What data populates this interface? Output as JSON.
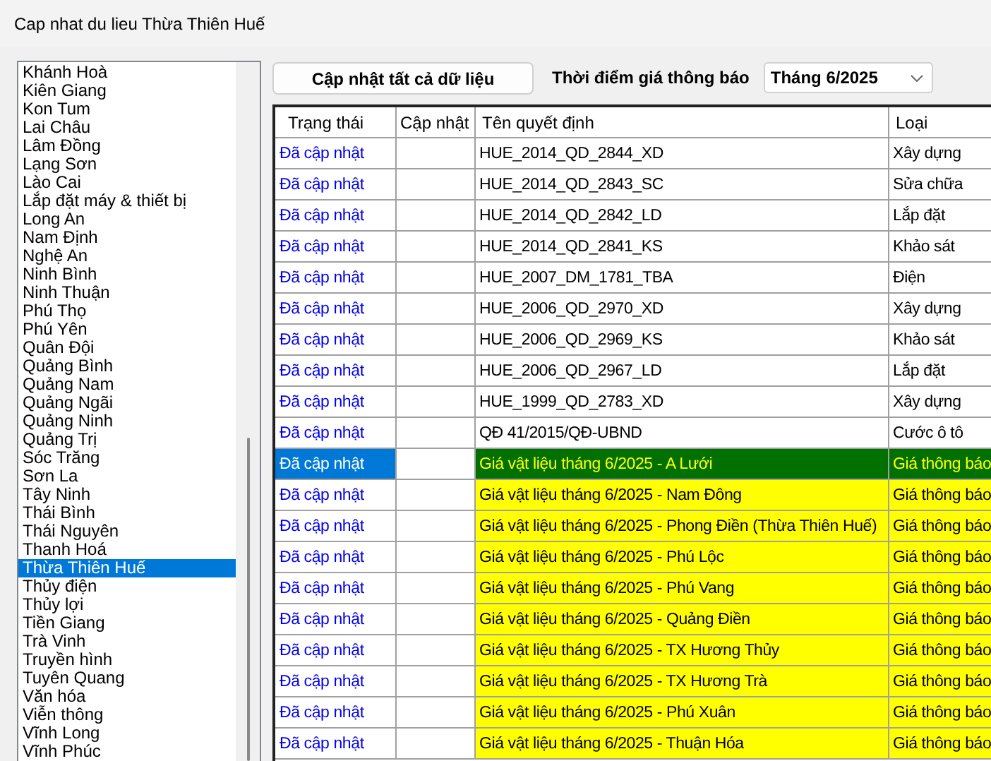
{
  "window": {
    "title": "Cap nhat du lieu Thừa Thiên Huế"
  },
  "list": [
    {
      "label": "Khánh Hoà",
      "selected": false
    },
    {
      "label": "Kiên Giang",
      "selected": false
    },
    {
      "label": "Kon Tum",
      "selected": false
    },
    {
      "label": "Lai Châu",
      "selected": false
    },
    {
      "label": "Lâm Đồng",
      "selected": false
    },
    {
      "label": "Lạng Sơn",
      "selected": false
    },
    {
      "label": "Lào Cai",
      "selected": false
    },
    {
      "label": "Lắp đặt máy & thiết bị",
      "selected": false
    },
    {
      "label": "Long An",
      "selected": false
    },
    {
      "label": "Nam Định",
      "selected": false
    },
    {
      "label": "Nghệ An",
      "selected": false
    },
    {
      "label": "Ninh Bình",
      "selected": false
    },
    {
      "label": "Ninh Thuận",
      "selected": false
    },
    {
      "label": "Phú Thọ",
      "selected": false
    },
    {
      "label": "Phú Yên",
      "selected": false
    },
    {
      "label": "Quân Đội",
      "selected": false
    },
    {
      "label": "Quảng Bình",
      "selected": false
    },
    {
      "label": "Quảng Nam",
      "selected": false
    },
    {
      "label": "Quảng Ngãi",
      "selected": false
    },
    {
      "label": "Quảng Ninh",
      "selected": false
    },
    {
      "label": "Quảng Trị",
      "selected": false
    },
    {
      "label": "Sóc Trăng",
      "selected": false
    },
    {
      "label": "Sơn La",
      "selected": false
    },
    {
      "label": "Tây Ninh",
      "selected": false
    },
    {
      "label": "Thái Bình",
      "selected": false
    },
    {
      "label": "Thái Nguyên",
      "selected": false
    },
    {
      "label": "Thanh Hoá",
      "selected": false
    },
    {
      "label": "Thừa Thiên Huế",
      "selected": true
    },
    {
      "label": "Thủy điện",
      "selected": false
    },
    {
      "label": "Thủy lợi",
      "selected": false
    },
    {
      "label": "Tiền Giang",
      "selected": false
    },
    {
      "label": "Trà Vinh",
      "selected": false
    },
    {
      "label": "Truyền hình",
      "selected": false
    },
    {
      "label": "Tuyên Quang",
      "selected": false
    },
    {
      "label": "Văn hóa",
      "selected": false
    },
    {
      "label": "Viễn thông",
      "selected": false
    },
    {
      "label": "Vĩnh Long",
      "selected": false
    },
    {
      "label": "Vĩnh Phúc",
      "selected": false
    }
  ],
  "update_all_button": "Cập nhật tất cả dữ liệu",
  "period": {
    "label": "Thời điểm giá thông báo",
    "value": "Tháng 6/2025"
  },
  "table": {
    "columns": [
      "Trạng thái",
      "Cập nhật",
      "Tên quyết định",
      "Loại"
    ],
    "rows": [
      {
        "status": "Đã cập nhật",
        "name": "HUE_2014_QD_2844_XD",
        "type": "Xây dựng",
        "selected": false,
        "highlighted": false
      },
      {
        "status": "Đã cập nhật",
        "name": "HUE_2014_QD_2843_SC",
        "type": "Sửa chữa",
        "selected": false,
        "highlighted": false
      },
      {
        "status": "Đã cập nhật",
        "name": "HUE_2014_QD_2842_LD",
        "type": "Lắp đặt",
        "selected": false,
        "highlighted": false
      },
      {
        "status": "Đã cập nhật",
        "name": "HUE_2014_QD_2841_KS",
        "type": "Khảo sát",
        "selected": false,
        "highlighted": false
      },
      {
        "status": "Đã cập nhật",
        "name": "HUE_2007_DM_1781_TBA",
        "type": "Điện",
        "selected": false,
        "highlighted": false
      },
      {
        "status": "Đã cập nhật",
        "name": "HUE_2006_QD_2970_XD",
        "type": "Xây dựng",
        "selected": false,
        "highlighted": false
      },
      {
        "status": "Đã cập nhật",
        "name": "HUE_2006_QD_2969_KS",
        "type": "Khảo sát",
        "selected": false,
        "highlighted": false
      },
      {
        "status": "Đã cập nhật",
        "name": "HUE_2006_QD_2967_LD",
        "type": "Lắp đặt",
        "selected": false,
        "highlighted": false
      },
      {
        "status": "Đã cập nhật",
        "name": "HUE_1999_QD_2783_XD",
        "type": "Xây dựng",
        "selected": false,
        "highlighted": false
      },
      {
        "status": "Đã cập nhật",
        "name": "QĐ 41/2015/QĐ-UBND",
        "type": "Cước ô tô",
        "selected": false,
        "highlighted": false
      },
      {
        "status": "Đã cập nhật",
        "name": "Giá vật liệu tháng 6/2025 - A Lưới",
        "type": "Giá thông báo",
        "selected": true,
        "highlighted": true
      },
      {
        "status": "Đã cập nhật",
        "name": "Giá vật liệu tháng 6/2025 - Nam Đông",
        "type": "Giá thông báo",
        "selected": false,
        "highlighted": true
      },
      {
        "status": "Đã cập nhật",
        "name": "Giá vật liệu tháng 6/2025 - Phong Điền (Thừa Thiên Huế)",
        "type": "Giá thông báo",
        "selected": false,
        "highlighted": true
      },
      {
        "status": "Đã cập nhật",
        "name": "Giá vật liệu tháng 6/2025 - Phú Lộc",
        "type": "Giá thông báo",
        "selected": false,
        "highlighted": true
      },
      {
        "status": "Đã cập nhật",
        "name": "Giá vật liệu tháng 6/2025 - Phú Vang",
        "type": "Giá thông báo",
        "selected": false,
        "highlighted": true
      },
      {
        "status": "Đã cập nhật",
        "name": "Giá vật liệu tháng 6/2025 - Quảng Điền",
        "type": "Giá thông báo",
        "selected": false,
        "highlighted": true
      },
      {
        "status": "Đã cập nhật",
        "name": "Giá vật liệu tháng 6/2025 - TX Hương Thủy",
        "type": "Giá thông báo",
        "selected": false,
        "highlighted": true
      },
      {
        "status": "Đã cập nhật",
        "name": "Giá vật liệu tháng 6/2025 - TX Hương Trà",
        "type": "Giá thông báo",
        "selected": false,
        "highlighted": true
      },
      {
        "status": "Đã cập nhật",
        "name": "Giá vật liệu tháng 6/2025 - Phú Xuân",
        "type": "Giá thông báo",
        "selected": false,
        "highlighted": true
      },
      {
        "status": "Đã cập nhật",
        "name": "Giá vật liệu tháng 6/2025 - Thuận Hóa",
        "type": "Giá thông báo",
        "selected": false,
        "highlighted": true
      }
    ]
  }
}
